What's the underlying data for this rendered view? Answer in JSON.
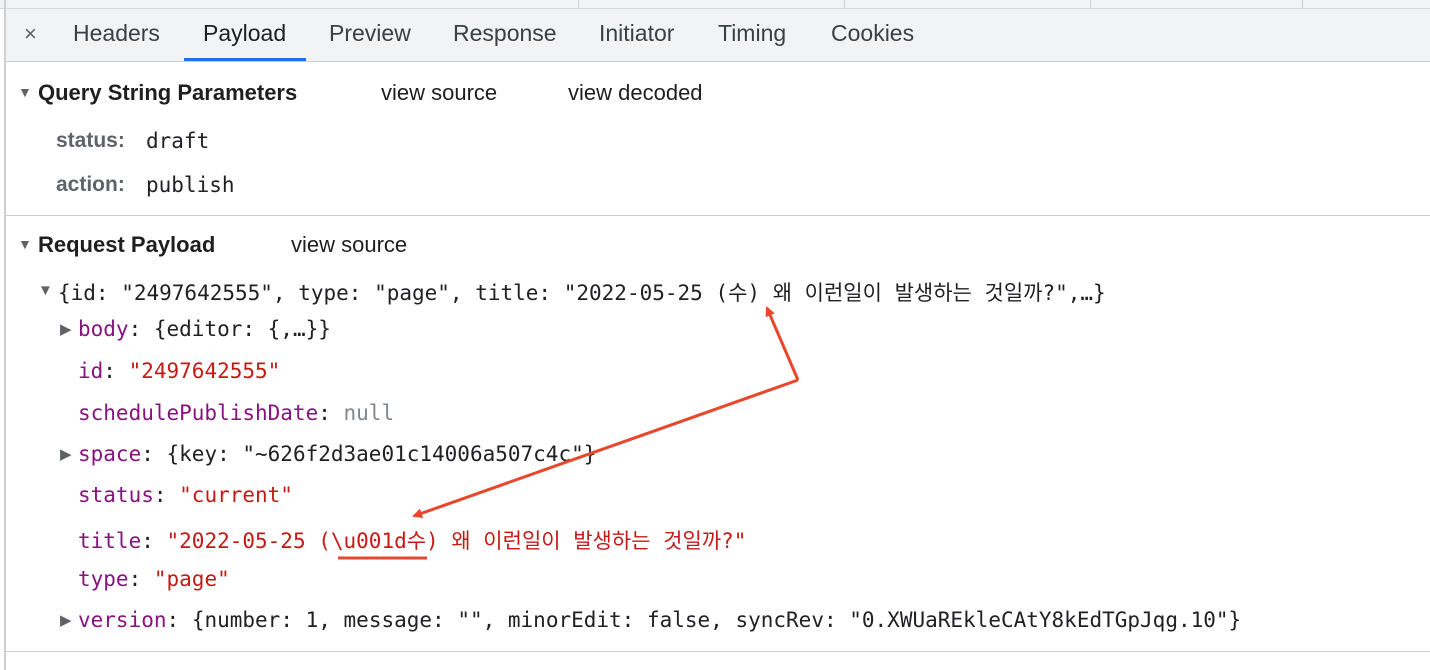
{
  "tabs": {
    "close": "×",
    "items": [
      "Headers",
      "Payload",
      "Preview",
      "Response",
      "Initiator",
      "Timing",
      "Cookies"
    ],
    "active": "Payload"
  },
  "query": {
    "title": "Query String Parameters",
    "view_source": "view source",
    "view_decoded": "view decoded",
    "params": [
      {
        "key": "status:",
        "value": "draft"
      },
      {
        "key": "action:",
        "value": "publish"
      }
    ]
  },
  "payload": {
    "title": "Request Payload",
    "view_source": "view source",
    "summary": "{id: \"2497642555\", type: \"page\", title: \"2022-05-25 (수) 왜 이런일이 발생하는 것일까?\",…}",
    "body_key": "body",
    "body_val": "{editor: {,…}}",
    "id_key": "id",
    "id_val": "\"2497642555\"",
    "schedule_key": "schedulePublishDate",
    "schedule_val": "null",
    "space_key": "space",
    "space_val": "{key: \"~626f2d3ae01c14006a507c4c\"}",
    "status_key": "status",
    "status_val": "\"current\"",
    "title_key": "title",
    "title_val": "\"2022-05-25 (\\u001d수) 왜 이런일이 발생하는 것일까?\"",
    "type_key": "type",
    "type_val": "\"page\"",
    "version_key": "version",
    "version_val": "{number: 1, message: \"\", minorEdit: false, syncRev: \"0.XWUaREkleCAtY8kEdTGpJqg.10\"}"
  },
  "icons": {
    "expanded": "triangle-down-icon",
    "collapsed": "triangle-right-icon"
  },
  "colors": {
    "key": "#881280",
    "string": "#c41a16",
    "null": "#80868b",
    "active_tab": "#1a73e8",
    "annotation": "#e8472c"
  }
}
